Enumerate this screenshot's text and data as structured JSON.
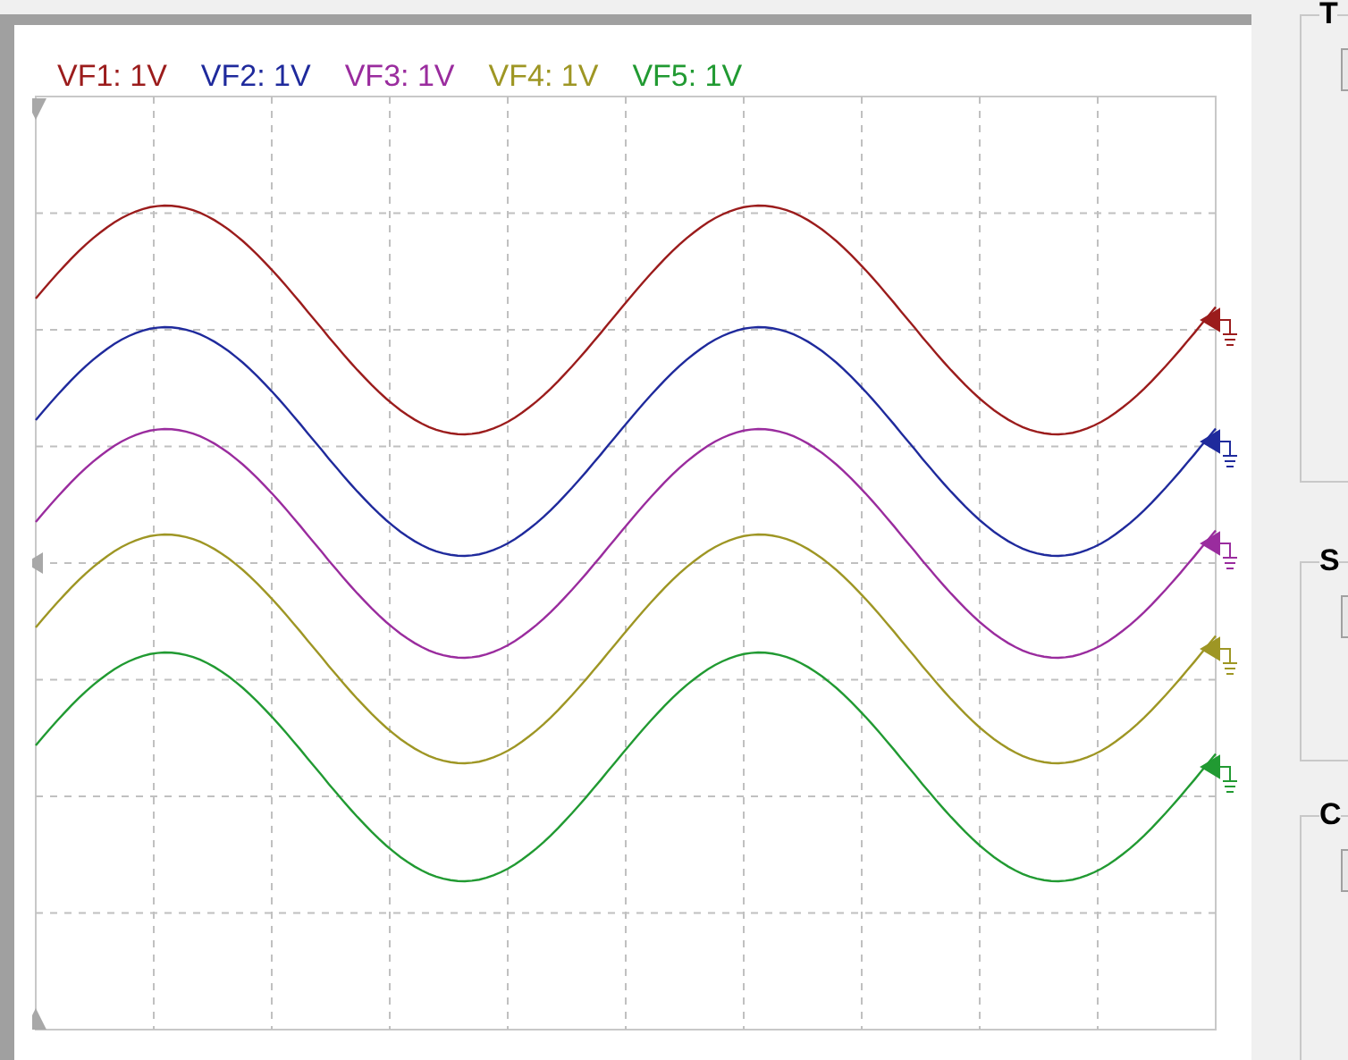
{
  "traces": [
    {
      "label": "VF1: 1V",
      "color": "#9b1c1c"
    },
    {
      "label": "VF2: 1V",
      "color": "#1f2a9c"
    },
    {
      "label": "VF3: 1V",
      "color": "#9a2c9e"
    },
    {
      "label": "VF4: 1V",
      "color": "#9e9624"
    },
    {
      "label": "VF5: 1V",
      "color": "#219a32"
    }
  ],
  "side_groups": [
    {
      "title": "T"
    },
    {
      "title": "S"
    },
    {
      "title": "C"
    }
  ]
}
